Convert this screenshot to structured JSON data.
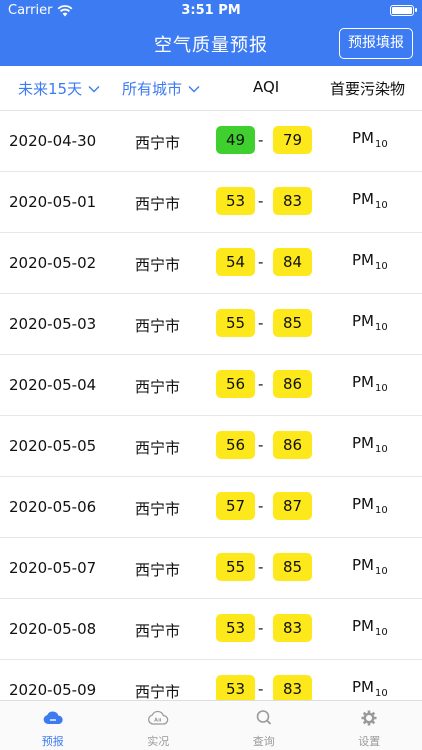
{
  "status_bar": {
    "carrier": "Carrier",
    "time": "3:51 PM"
  },
  "nav": {
    "title": "空气质量预报",
    "fill_button": "预报填报"
  },
  "filters": {
    "range": "未来15天",
    "city": "所有城市",
    "aqi_header": "AQI",
    "pollutant_header": "首要污染物"
  },
  "colors": {
    "brand": "#3d7bf2",
    "good": "#3fcf2f",
    "moderate": "#fde81b"
  },
  "rows": [
    {
      "date": "2020-04-30",
      "city": "西宁市",
      "aqi_low": "49",
      "aqi_high": "79",
      "low_level": "good",
      "high_level": "moderate",
      "pollutant": "PM",
      "pollutant_sub": "10"
    },
    {
      "date": "2020-05-01",
      "city": "西宁市",
      "aqi_low": "53",
      "aqi_high": "83",
      "low_level": "moderate",
      "high_level": "moderate",
      "pollutant": "PM",
      "pollutant_sub": "10"
    },
    {
      "date": "2020-05-02",
      "city": "西宁市",
      "aqi_low": "54",
      "aqi_high": "84",
      "low_level": "moderate",
      "high_level": "moderate",
      "pollutant": "PM",
      "pollutant_sub": "10"
    },
    {
      "date": "2020-05-03",
      "city": "西宁市",
      "aqi_low": "55",
      "aqi_high": "85",
      "low_level": "moderate",
      "high_level": "moderate",
      "pollutant": "PM",
      "pollutant_sub": "10"
    },
    {
      "date": "2020-05-04",
      "city": "西宁市",
      "aqi_low": "56",
      "aqi_high": "86",
      "low_level": "moderate",
      "high_level": "moderate",
      "pollutant": "PM",
      "pollutant_sub": "10"
    },
    {
      "date": "2020-05-05",
      "city": "西宁市",
      "aqi_low": "56",
      "aqi_high": "86",
      "low_level": "moderate",
      "high_level": "moderate",
      "pollutant": "PM",
      "pollutant_sub": "10"
    },
    {
      "date": "2020-05-06",
      "city": "西宁市",
      "aqi_low": "57",
      "aqi_high": "87",
      "low_level": "moderate",
      "high_level": "moderate",
      "pollutant": "PM",
      "pollutant_sub": "10"
    },
    {
      "date": "2020-05-07",
      "city": "西宁市",
      "aqi_low": "55",
      "aqi_high": "85",
      "low_level": "moderate",
      "high_level": "moderate",
      "pollutant": "PM",
      "pollutant_sub": "10"
    },
    {
      "date": "2020-05-08",
      "city": "西宁市",
      "aqi_low": "53",
      "aqi_high": "83",
      "low_level": "moderate",
      "high_level": "moderate",
      "pollutant": "PM",
      "pollutant_sub": "10"
    },
    {
      "date": "2020-05-09",
      "city": "西宁市",
      "aqi_low": "53",
      "aqi_high": "83",
      "low_level": "moderate",
      "high_level": "moderate",
      "pollutant": "PM",
      "pollutant_sub": "10"
    }
  ],
  "tabs": [
    {
      "label": "预报",
      "icon": "cloud-icon",
      "active": true
    },
    {
      "label": "实况",
      "icon": "aqi-cloud-icon",
      "active": false
    },
    {
      "label": "查询",
      "icon": "search-icon",
      "active": false
    },
    {
      "label": "设置",
      "icon": "gear-icon",
      "active": false
    }
  ]
}
